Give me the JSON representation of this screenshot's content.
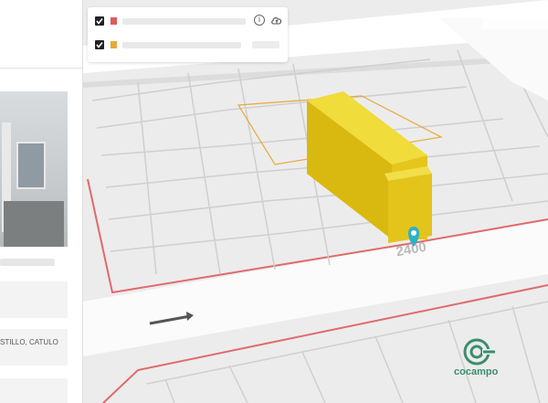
{
  "left_panel": {
    "address_text": "STILLO, CATULO"
  },
  "layers": {
    "rows": [
      {
        "checked": true,
        "color": "#e05a5a"
      },
      {
        "checked": true,
        "color": "#e8a93a"
      }
    ],
    "info_icon": "info-icon",
    "cloud_icon": "cloud-upload-icon"
  },
  "map": {
    "street_number": "2400",
    "direction_icon": "arrow-right-icon",
    "marker_icon": "location-pin-icon",
    "building_color": "#e3c41a",
    "boundary_color": "#e06a6a"
  },
  "logo": {
    "text": "cocampo",
    "color": "#3c8d6e"
  }
}
